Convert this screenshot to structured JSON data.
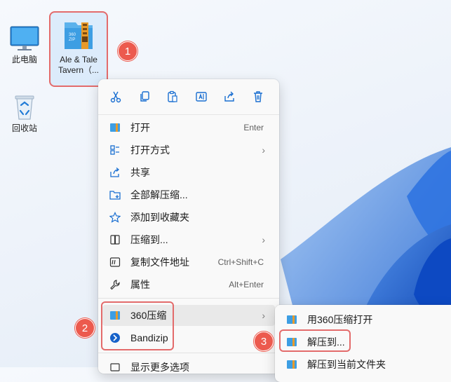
{
  "desktop": {
    "icons": [
      {
        "label": "此电脑"
      },
      {
        "label": "回收站"
      }
    ],
    "selected_file": {
      "label_line1": "Ale & Tale",
      "label_line2": "Tavern（..."
    }
  },
  "badges": {
    "one": "1",
    "two": "2",
    "three": "3"
  },
  "context_menu": {
    "toolbar": [
      "cut-icon",
      "copy-icon",
      "paste-icon",
      "rename-icon",
      "share-icon",
      "delete-icon"
    ],
    "items": [
      {
        "label": "打开",
        "shortcut": "Enter"
      },
      {
        "label": "打开方式",
        "arrow": "›"
      },
      {
        "label": "共享"
      },
      {
        "label": "全部解压缩..."
      },
      {
        "label": "添加到收藏夹"
      },
      {
        "label": "压缩到...",
        "arrow": "›"
      },
      {
        "label": "复制文件地址",
        "shortcut": "Ctrl+Shift+C"
      },
      {
        "label": "属性",
        "shortcut": "Alt+Enter"
      },
      {
        "label": "360压缩",
        "arrow": "›"
      },
      {
        "label": "Bandizip"
      },
      {
        "label": "显示更多选项"
      }
    ]
  },
  "submenu": {
    "items": [
      {
        "label": "用360压缩打开"
      },
      {
        "label": "解压到..."
      },
      {
        "label": "解压到当前文件夹"
      }
    ]
  },
  "colors": {
    "accent": "#0067c0",
    "highlight": "#e36b6b",
    "badge": "#ec5a4e"
  }
}
